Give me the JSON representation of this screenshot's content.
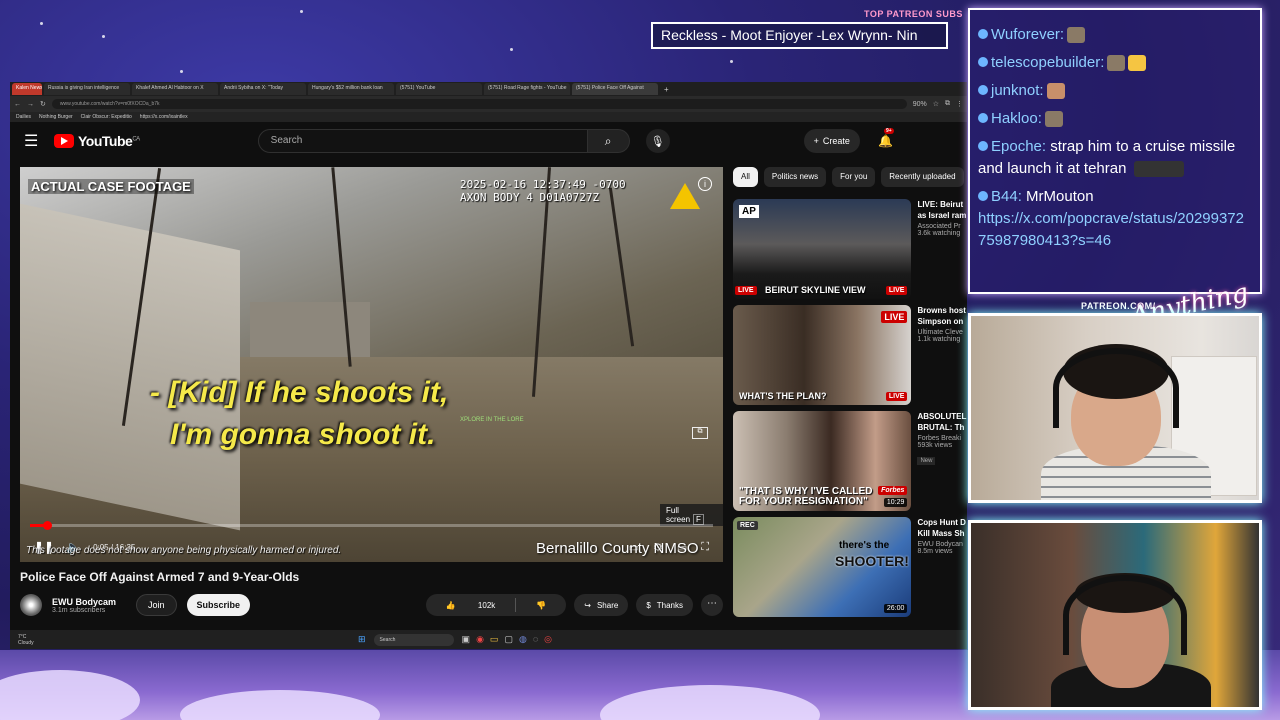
{
  "overlay": {
    "patreon_subs_label": "TOP PATREON SUBS",
    "ticker_text": "Reckless - Moot Enjoyer -Lex Wrynn- Nin",
    "patreon_url": "PATREON.COM/",
    "signature": "Anything"
  },
  "browser": {
    "tabs": [
      {
        "label": "Kalen News",
        "active": false
      },
      {
        "label": "Russia is giving Iran intelligence",
        "active": false
      },
      {
        "label": "Khalef Ahmed Al Habtoor on X",
        "active": false
      },
      {
        "label": "Andrii Sybiha on X: \"Today",
        "active": false
      },
      {
        "label": "Hungary's $52 million bank loan",
        "active": false
      },
      {
        "label": "(5751) YouTube",
        "active": false
      },
      {
        "label": "(5751) Road Rage fights - YouTube",
        "active": false
      },
      {
        "label": "(5751) Police Face Off Against",
        "active": true
      }
    ],
    "new_tab": "+",
    "url": "www.youtube.com/watch?v=m0fXOCDa_b7k",
    "zoom": "90%",
    "bookmarks": [
      "Dailies",
      "Nothing Burger",
      "Clair Obscur: Expeditio",
      "https://x.com/ixaintlex"
    ]
  },
  "youtube": {
    "logo_text": "YouTube",
    "logo_region": "CA",
    "search_placeholder": "Search",
    "create_label": "Create",
    "notification_count": "9+"
  },
  "video": {
    "case_label": "ACTUAL CASE FOOTAGE",
    "axon_timestamp": "2025-02-16 12:37:49 -0700",
    "axon_device": "AXON BODY 4 D01A0727Z",
    "subtitle_line1": "- [Kid] If he shoots it,",
    "subtitle_line2": "I'm gonna shoot it.",
    "explore_text": "XPLORE IN THE LORE",
    "fullscreen_tip": "Full screen",
    "fullscreen_key": "F",
    "current_time": "0:05",
    "time_separator": "/",
    "duration": "16:35",
    "progress_fraction": 0.005,
    "disclaimer": "This footage does not show anyone being physically harmed or injured.",
    "county": "Bernalillo County NMSO",
    "title": "Police Face Off Against Armed 7 and 9-Year-Olds"
  },
  "channel": {
    "name": "EWU Bodycam",
    "subscribers": "3.1m subscribers",
    "join_label": "Join",
    "subscribe_label": "Subscribe",
    "likes": "102k",
    "share_label": "Share",
    "thanks_label": "Thanks",
    "more_label": "⋯"
  },
  "sidebar": {
    "chips": [
      {
        "label": "All",
        "active": true
      },
      {
        "label": "Politics news",
        "active": false
      },
      {
        "label": "For you",
        "active": false
      },
      {
        "label": "Recently uploaded",
        "active": false
      }
    ],
    "videos": [
      {
        "title": "LIVE: Beirut",
        "title2": "as Israel ram",
        "channel": "Associated Pr",
        "views": "3.6k watching",
        "caption": "BEIRUT SKYLINE VIEW",
        "badge": "LIVE",
        "logo": "AP",
        "live_left": "LIVE"
      },
      {
        "title": "Browns host",
        "title2": "Simpson on",
        "channel": "Ultimate Cleve",
        "views": "1.1k watching",
        "caption": "WHAT'S THE PLAN?",
        "badge": "LIVE",
        "top_badge": "LIVE"
      },
      {
        "title": "ABSOLUTEL",
        "title2": "BRUTAL: Th",
        "channel": "Forbes Breaki",
        "views": "593k views",
        "new": "New",
        "caption": "\"THAT IS WHY I'VE CALLED",
        "caption2": "FOR YOUR RESIGNATION\"",
        "duration": "10:29",
        "brand": "Forbes"
      },
      {
        "title": "Cops Hunt D",
        "title2": "Kill Mass Sh",
        "channel": "EWU Bodycan",
        "views": "8.5m views",
        "caption": "there's the",
        "caption2": "SHOOTER!",
        "duration": "26:00",
        "rec": "REC"
      }
    ]
  },
  "taskbar": {
    "weather_temp": "7°C",
    "weather_desc": "Cloudy",
    "search_label": "Search"
  },
  "chat": {
    "messages": [
      {
        "user": "Wuforever:",
        "text": ""
      },
      {
        "user": "telescopebuilder:",
        "text": ""
      },
      {
        "user": "junknot:",
        "text": ""
      },
      {
        "user": "Hakloo:",
        "text": ""
      },
      {
        "user": "Epoche:",
        "text": "strap him to a cruise missile and launch it at tehran"
      },
      {
        "user": "B44:",
        "text": "MrMouton"
      }
    ],
    "link": "https://x.com/popcrave/status/2029937275987980413?s=46"
  }
}
